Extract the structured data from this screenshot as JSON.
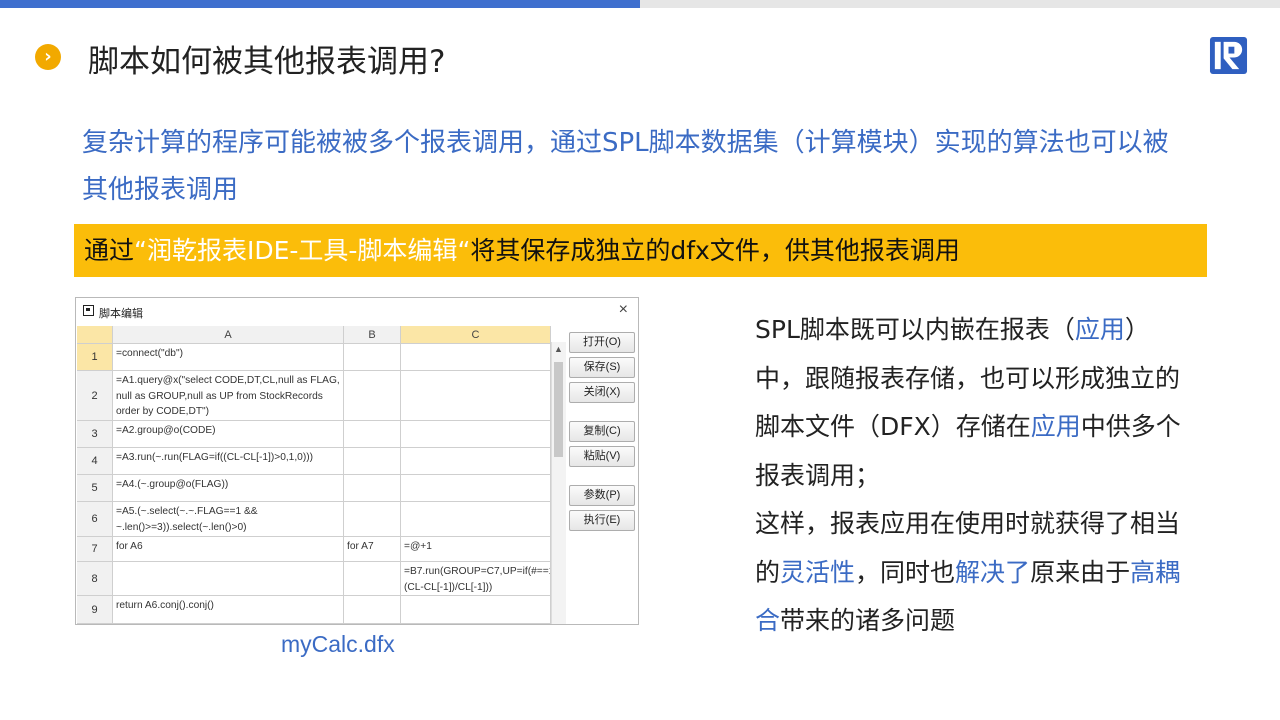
{
  "slide": {
    "title": "脚本如何被其他报表调用?",
    "bullet_icon": "chevron-right-icon",
    "logo_icon": "runqian-logo-icon",
    "accent_blue": "#3f6fce",
    "accent_yellow": "#fbbd0a"
  },
  "intro": {
    "text": "复杂计算的程序可能被被多个报表调用，通过SPL脚本数据集（计算模块）实现的算法也可以被其他报表调用"
  },
  "banner": {
    "prefix": "通过",
    "quote_open": "“",
    "quoted": "润乾报表IDE-工具-脚本编辑",
    "quote_close": "“",
    "suffix": "将其保存成独立的dfx文件，供其他报表调用"
  },
  "editor": {
    "window_title": "脚本编辑",
    "close_glyph": "×",
    "columns": [
      "A",
      "B",
      "C"
    ],
    "rows": [
      {
        "num": "1",
        "A": "=connect(\"db\")",
        "B": "",
        "C": ""
      },
      {
        "num": "2",
        "A": "=A1.query@x(\"select CODE,DT,CL,null as FLAG, null as GROUP,null as UP from StockRecords order by CODE,DT\")",
        "B": "",
        "C": ""
      },
      {
        "num": "3",
        "A": "=A2.group@o(CODE)",
        "B": "",
        "C": ""
      },
      {
        "num": "4",
        "A": "=A3.run(~.run(FLAG=if((CL-CL[-1])>0,1,0)))",
        "B": "",
        "C": ""
      },
      {
        "num": "5",
        "A": "=A4.(~.group@o(FLAG))",
        "B": "",
        "C": ""
      },
      {
        "num": "6",
        "A": "=A5.(~.select(~.~.FLAG==1 && ~.len()>=3)).select(~.len()>0)",
        "B": "",
        "C": ""
      },
      {
        "num": "7",
        "A": "for A6",
        "B": "for A7",
        "C": "=@+1"
      },
      {
        "num": "8",
        "A": "",
        "B": "",
        "C": "=B7.run(GROUP=C7,UP=if(#==1,0,(CL-CL[-1])/CL[-1]))"
      },
      {
        "num": "9",
        "A": "return A6.conj().conj()",
        "B": "",
        "C": ""
      }
    ],
    "buttons": {
      "open": "打开(O)",
      "save": "保存(S)",
      "close": "关闭(X)",
      "copy": "复制(C)",
      "paste": "粘贴(V)",
      "params": "参数(P)",
      "run": "执行(E)"
    },
    "caption": "myCalc.dfx"
  },
  "side": {
    "p1_a": "SPL脚本既可以内嵌在报表（",
    "p1_hl1": "应用",
    "p1_b": "）中，跟随报表存储，也可以形成独立的脚本文件（DFX）存储在",
    "p1_hl2": "应用",
    "p1_c": "中供多个报表调用；",
    "p2_a": "这样，报表应用在使用时就获得了相当的",
    "p2_hl1": "灵活性",
    "p2_b": "，同时也",
    "p2_hl2": "解决了",
    "p2_c": "原来由于",
    "p2_hl3": "高耦合",
    "p2_d": "带来的诸多问题"
  }
}
